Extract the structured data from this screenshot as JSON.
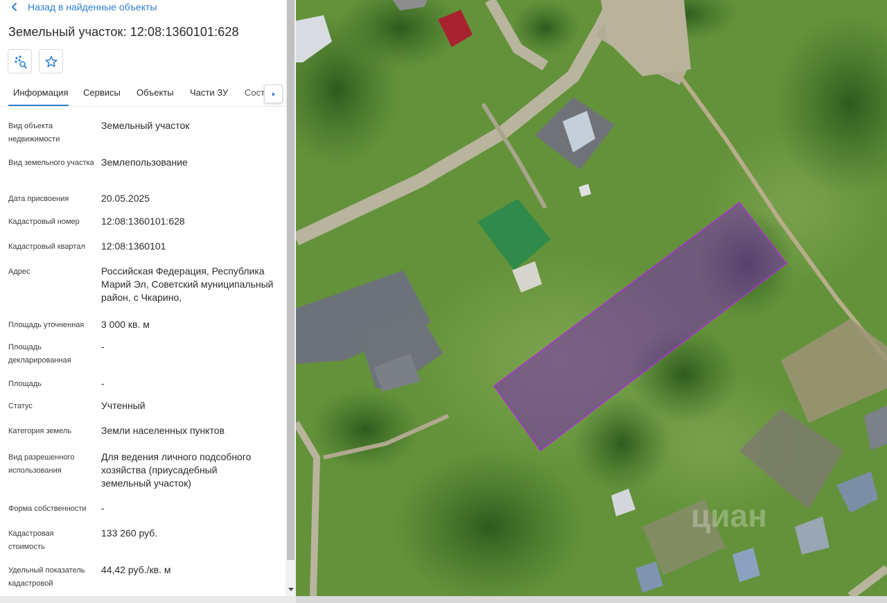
{
  "panel": {
    "back_label": "Назад в найденные объекты",
    "title": "Земельный участок: 12:08:1360101:628",
    "tabs": [
      {
        "label": "Информация",
        "active": true
      },
      {
        "label": "Сервисы"
      },
      {
        "label": "Объекты"
      },
      {
        "label": "Части ЗУ"
      },
      {
        "label": "Состав"
      }
    ],
    "properties": [
      {
        "label": "Вид объекта недвижимости",
        "value": "Земельный участок"
      },
      {
        "label": "Вид земельного участка",
        "value": "Землепользование"
      },
      {
        "label": "Дата присвоения",
        "value": "20.05.2025"
      },
      {
        "label": "Кадастровый номер",
        "value": "12:08:1360101:628"
      },
      {
        "label": "Кадастровый квартал",
        "value": "12:08:1360101"
      },
      {
        "label": "Адрес",
        "value": "Российская Федерация, Республика Марий Эл, Советский муниципальный район, с Чкарино,"
      },
      {
        "label": "Площадь уточненная",
        "value": "3 000 кв. м"
      },
      {
        "label": "Площадь декларированная",
        "value": "-"
      },
      {
        "label": "Площадь",
        "value": "-"
      },
      {
        "label": "Статус",
        "value": "Учтенный"
      },
      {
        "label": "Категория земель",
        "value": "Земли населенных пунктов"
      },
      {
        "label": "Вид разрешенного использования",
        "value": "Для ведения личного подсобного хозяйства (приусадебный земельный участок)"
      },
      {
        "label": "Форма собственности",
        "value": "-"
      },
      {
        "label": "Кадастровая стоимость",
        "value": "133 260 руб."
      },
      {
        "label": "Удельный показатель кадастровой",
        "value": "44,42 руб./кв. м"
      }
    ]
  },
  "map": {
    "watermark": "циан",
    "parcel_outline_color": "#b02fd6",
    "accent_color": "#2f7fd1"
  }
}
